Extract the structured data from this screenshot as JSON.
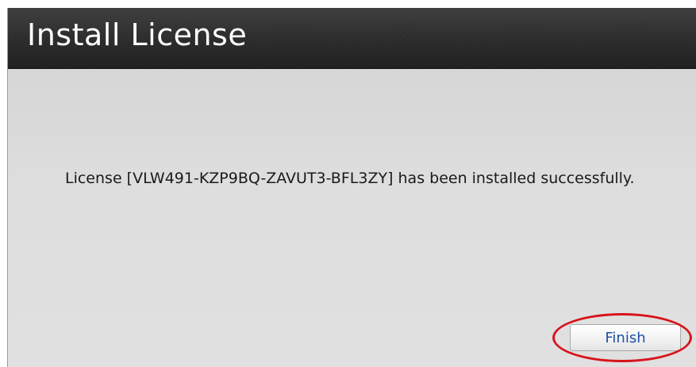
{
  "dialog": {
    "title": "Install License",
    "message": "License [VLW491-KZP9BQ-ZAVUT3-BFL3ZY] has been installed successfully.",
    "finish_label": "Finish"
  },
  "colors": {
    "title_bar": "#2e2e2e",
    "body": "#dcdcdc",
    "button_text": "#1f4fa3",
    "highlight": "#d8141c"
  }
}
